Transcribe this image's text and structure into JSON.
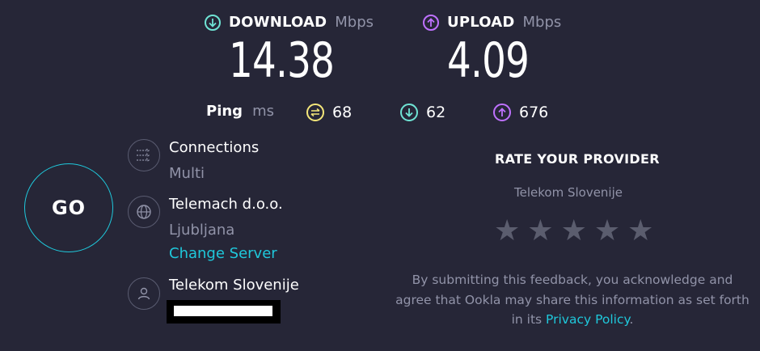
{
  "download": {
    "label": "DOWNLOAD",
    "unit": "Mbps",
    "value": "14.38",
    "icon": "arrow-down-circle-icon"
  },
  "upload": {
    "label": "UPLOAD",
    "unit": "Mbps",
    "value": "4.09",
    "icon": "arrow-up-circle-icon"
  },
  "ping": {
    "label": "Ping",
    "unit": "ms",
    "idle": "68",
    "down": "62",
    "up": "676"
  },
  "go_label": "GO",
  "connections": {
    "title": "Connections",
    "value": "Multi"
  },
  "server": {
    "name": "Telemach d.o.o.",
    "location": "Ljubljana",
    "change_label": "Change Server"
  },
  "provider": {
    "name": "Telekom Slovenije"
  },
  "rate": {
    "title": "RATE YOUR PROVIDER",
    "provider": "Telekom Slovenije",
    "stars": 5,
    "footer_text": "By submitting this feedback, you acknowledge and agree that Ookla may share this information as set forth in its",
    "privacy_link": "Privacy Policy",
    "footer_end": "."
  },
  "colors": {
    "background": "#262637",
    "download_accent": "#6fe3d4",
    "upload_accent": "#bf71ff",
    "ping_accent": "#f5e77a",
    "link": "#1fc8db"
  }
}
